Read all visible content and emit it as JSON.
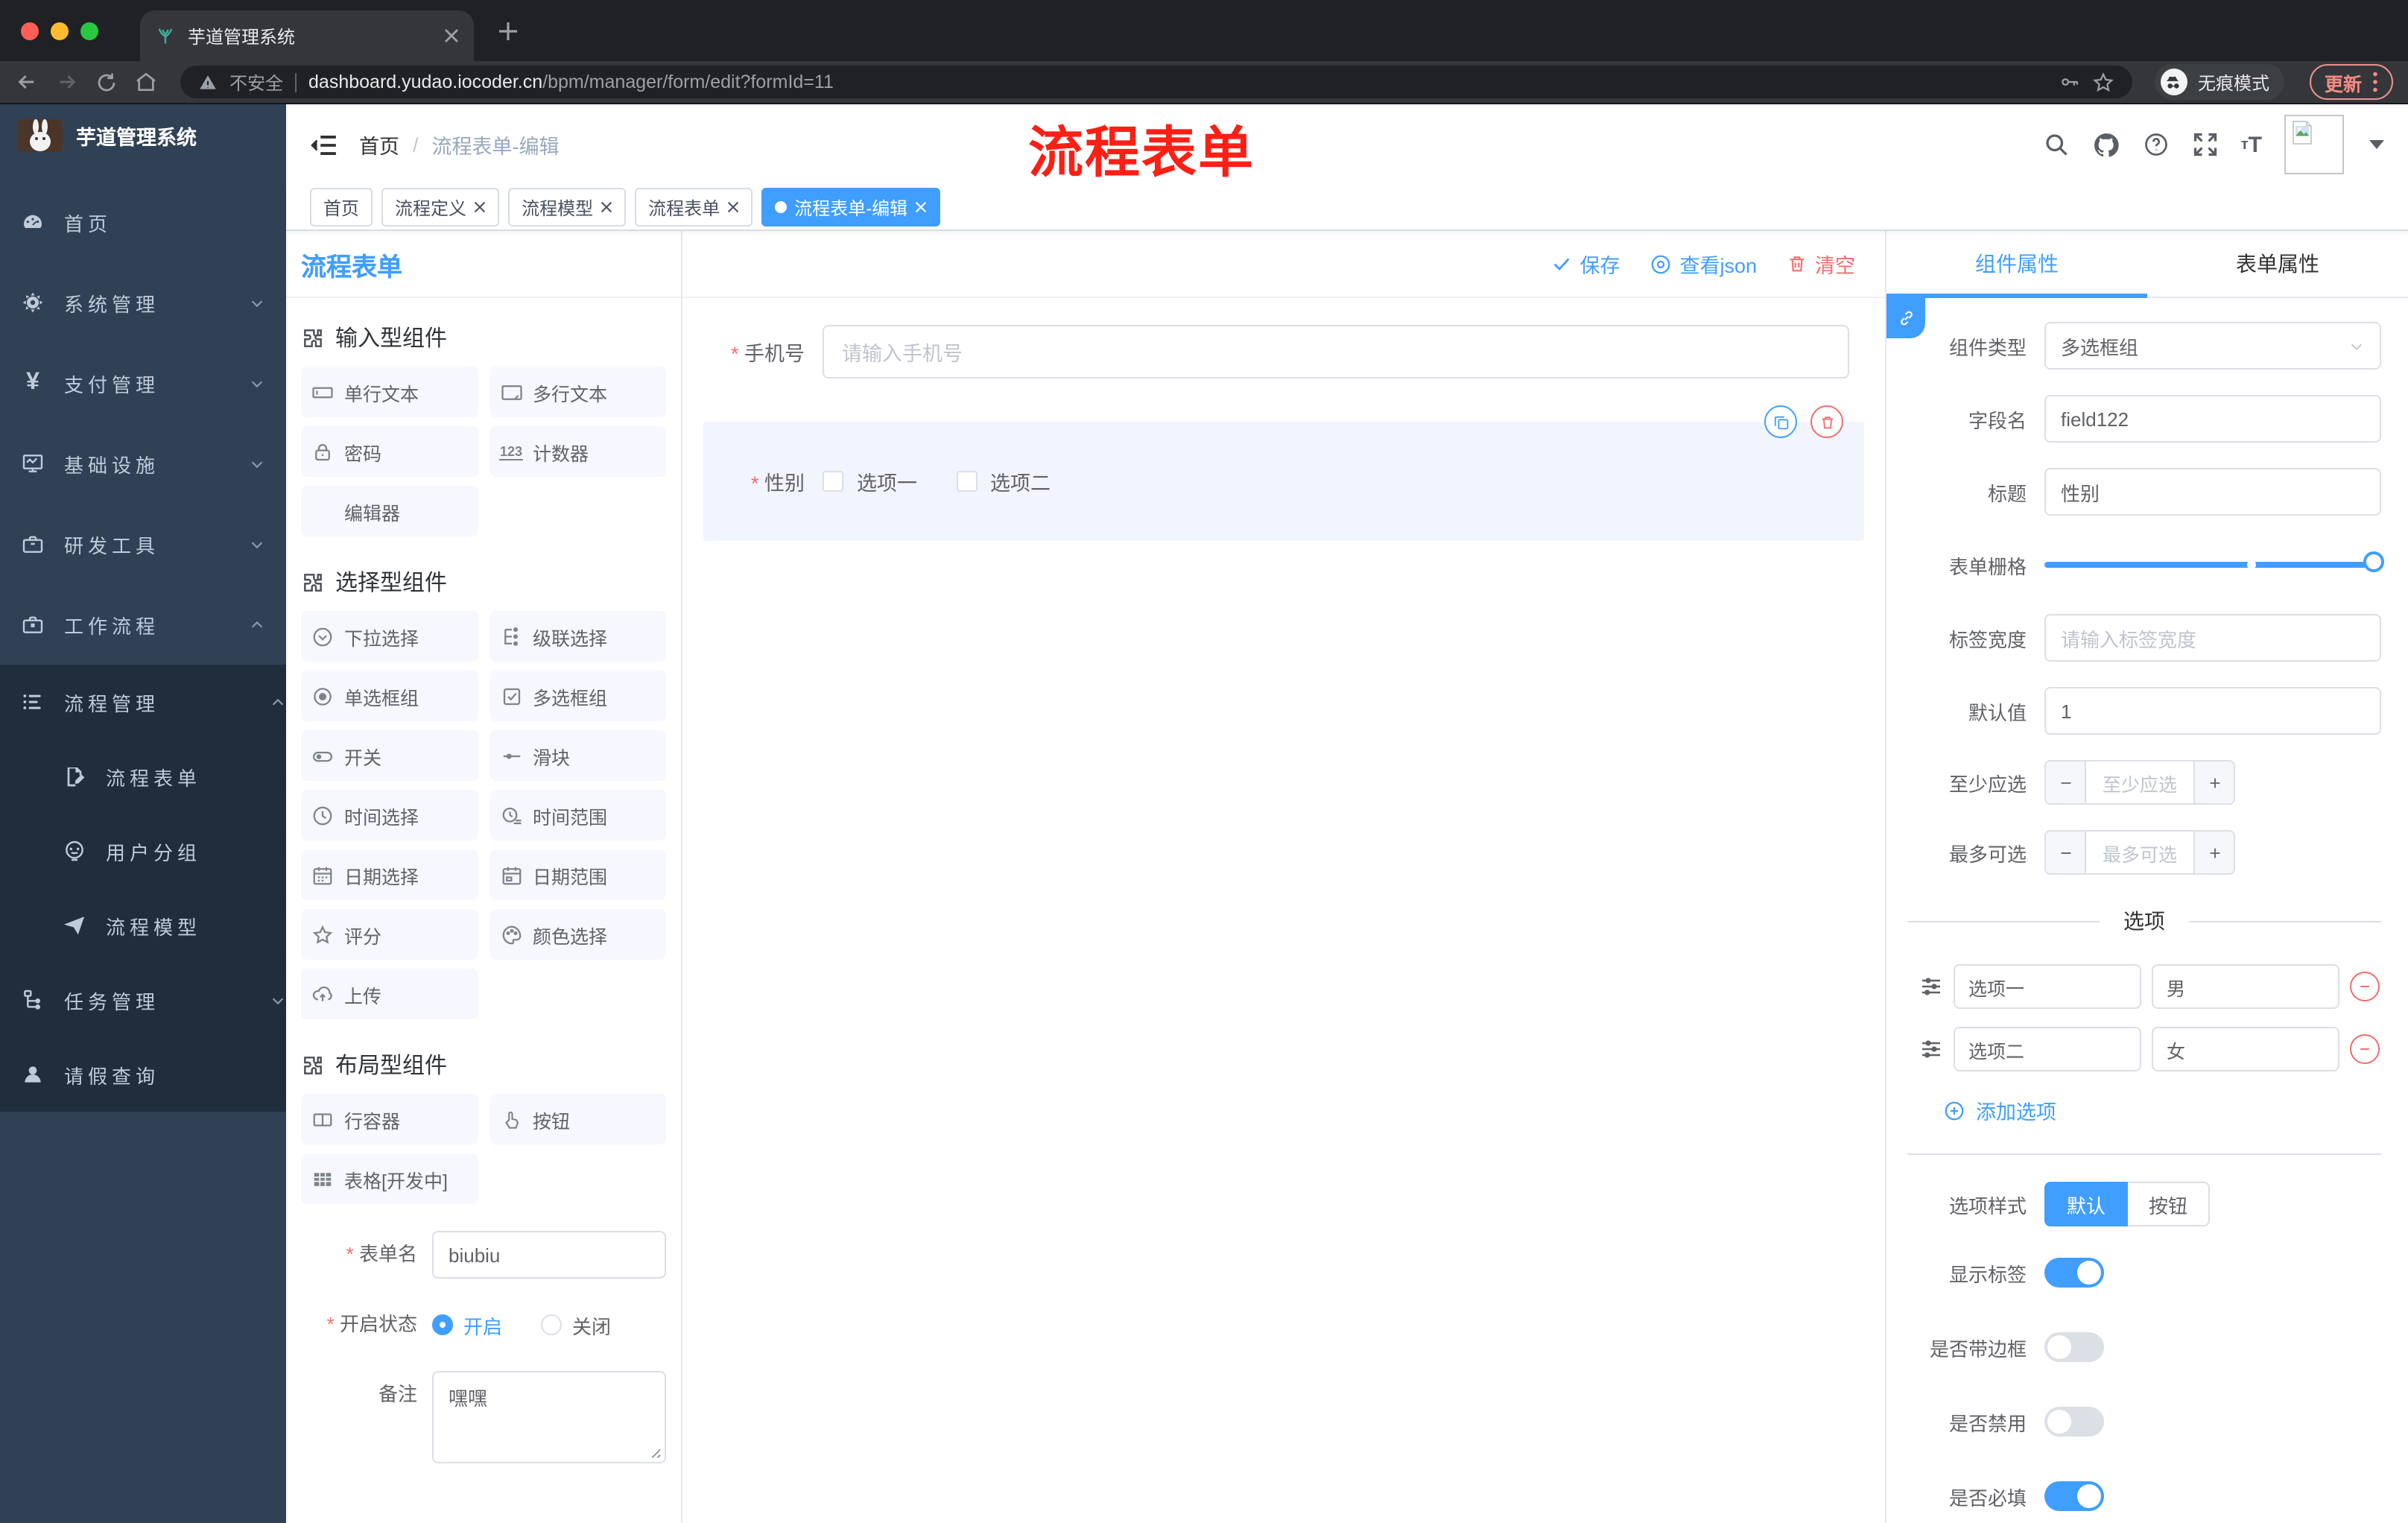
{
  "browser": {
    "tab_title": "芋道管理系统",
    "security_label": "不安全",
    "url_domain": "dashboard.yudao.iocoder.cn",
    "url_path": "/bpm/manager/form/edit?formId=11",
    "incognito_label": "无痕模式",
    "update_label": "更新"
  },
  "annotation": {
    "text": "流程表单",
    "color": "#fb2016"
  },
  "sidebar": {
    "logo_title": "芋道管理系统",
    "items": [
      {
        "label": "首页"
      },
      {
        "label": "系统管理"
      },
      {
        "label": "支付管理"
      },
      {
        "label": "基础设施"
      },
      {
        "label": "研发工具"
      },
      {
        "label": "工作流程"
      }
    ],
    "submenu": [
      {
        "label": "流程管理"
      },
      {
        "label": "流程表单"
      },
      {
        "label": "用户分组"
      },
      {
        "label": "流程模型"
      },
      {
        "label": "任务管理"
      },
      {
        "label": "请假查询"
      }
    ]
  },
  "header": {
    "breadcrumb_home": "首页",
    "breadcrumb_sep": "/",
    "breadcrumb_current": "流程表单-编辑"
  },
  "tags": [
    {
      "label": "首页"
    },
    {
      "label": "流程定义"
    },
    {
      "label": "流程模型"
    },
    {
      "label": "流程表单"
    },
    {
      "label": "流程表单-编辑"
    }
  ],
  "designer": {
    "panel_title": "流程表单",
    "toolbar": {
      "save": "保存",
      "view_json": "查看json",
      "clear": "清空"
    },
    "palette": {
      "sections": [
        {
          "title": "输入型组件",
          "items": [
            "单行文本",
            "多行文本",
            "密码",
            "计数器",
            "编辑器"
          ]
        },
        {
          "title": "选择型组件",
          "items": [
            "下拉选择",
            "级联选择",
            "单选框组",
            "多选框组",
            "开关",
            "滑块",
            "时间选择",
            "时间范围",
            "日期选择",
            "日期范围",
            "评分",
            "颜色选择",
            "上传"
          ]
        },
        {
          "title": "布局型组件",
          "items": [
            "行容器",
            "按钮",
            "表格[开发中]"
          ]
        }
      ]
    },
    "meta_form": {
      "form_name_label": "表单名",
      "form_name_value": "biubiu",
      "status_label": "开启状态",
      "status_on": "开启",
      "status_off": "关闭",
      "remark_label": "备注",
      "remark_value": "嘿嘿"
    },
    "canvas": {
      "phone_label": "手机号",
      "phone_placeholder": "请输入手机号",
      "gender_label": "性别",
      "gender_options": [
        "选项一",
        "选项二"
      ]
    },
    "props": {
      "tab_component": "组件属性",
      "tab_form": "表单属性",
      "component_type_label": "组件类型",
      "component_type_value": "多选框组",
      "field_name_label": "字段名",
      "field_name_value": "field122",
      "title_label": "标题",
      "title_value": "性别",
      "grid_label": "表单栅格",
      "label_width_label": "标签宽度",
      "label_width_placeholder": "请输入标签宽度",
      "default_label": "默认值",
      "default_value": "1",
      "min_label": "至少应选",
      "min_placeholder": "至少应选",
      "max_label": "最多可选",
      "max_placeholder": "最多可选",
      "options_divider": "选项",
      "options": [
        {
          "label": "选项一",
          "value": "男"
        },
        {
          "label": "选项二",
          "value": "女"
        }
      ],
      "add_option": "添加选项",
      "style_label": "选项样式",
      "style_default": "默认",
      "style_button": "按钮",
      "toggles": [
        {
          "label": "显示标签",
          "on": true
        },
        {
          "label": "是否带边框",
          "on": false
        },
        {
          "label": "是否禁用",
          "on": false
        },
        {
          "label": "是否必填",
          "on": true
        }
      ]
    }
  },
  "icons": {
    "counter_icon_text": "123",
    "font_size_icon_text": "tT"
  },
  "colors": {
    "accent": "#409eff",
    "danger": "#f56c6c",
    "annotation_red": "#fb2016",
    "sidebar_bg": "#304156",
    "submenu_bg": "#1f2d3d",
    "sidebar_text": "#bfcbd9",
    "chip_bg": "#f6f7ff",
    "selected_widget_bg": "#f2f5ff",
    "chrome_strip": "#1f2125",
    "chrome_toolbar": "#35363a",
    "chrome_url": "#202124",
    "update_red": "#f28b82"
  }
}
